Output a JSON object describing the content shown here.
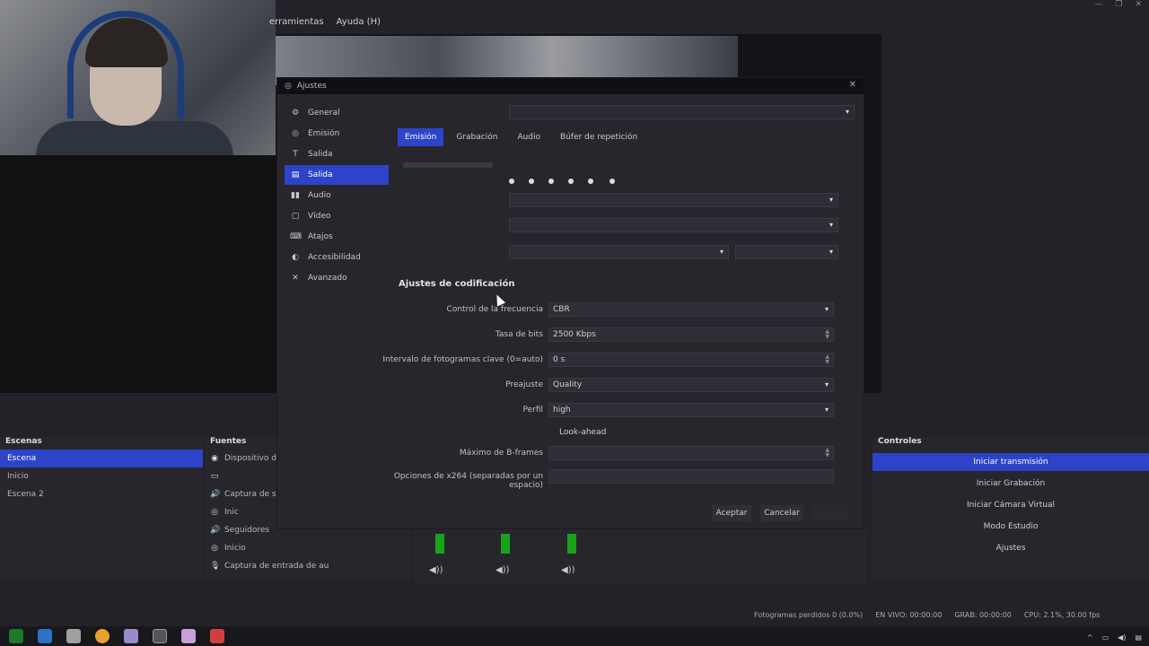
{
  "menubar": {
    "items": [
      "erramientas",
      "Ayuda (H)"
    ]
  },
  "window_controls": [
    "—",
    "❐",
    "✕"
  ],
  "scenes": {
    "title": "Escenas",
    "items": [
      {
        "label": "Escena",
        "selected": true
      },
      {
        "label": "Inicio",
        "selected": false
      },
      {
        "label": "Escena 2",
        "selected": false
      }
    ]
  },
  "sources": {
    "title": "Fuentes",
    "items": [
      {
        "icon": "camera-icon",
        "glyph": "◉",
        "label": "Dispositivo de c"
      },
      {
        "icon": "window-icon",
        "glyph": "▭",
        "label": ""
      },
      {
        "icon": "speaker-icon",
        "glyph": "🔊",
        "label": "Captura de s"
      },
      {
        "icon": "globe-icon",
        "glyph": "◎",
        "label": "Inic"
      },
      {
        "icon": "speaker-icon",
        "glyph": "🔊",
        "label": "Seguidores"
      },
      {
        "icon": "globe-icon",
        "glyph": "◎",
        "label": "Inicio"
      },
      {
        "icon": "mic-icon",
        "glyph": "🎙",
        "label": "Captura de entrada de au"
      }
    ]
  },
  "controls": {
    "title": "Controles",
    "buttons": [
      {
        "label": "Iniciar transmisión",
        "active": true
      },
      {
        "label": "Iniciar Grabación",
        "active": false
      },
      {
        "label": "Iniciar Cámara Virtual",
        "active": false
      },
      {
        "label": "Modo Estudio",
        "active": false
      },
      {
        "label": "Ajustes",
        "active": false
      }
    ]
  },
  "statusbar": {
    "items": [
      "Fotogramas perdidos 0 (0.0%)",
      "EN VIVO: 00:00:00",
      "GRAB: 00:00:00",
      "CPU: 2.1%, 30.00 fps"
    ]
  },
  "settings": {
    "title": "Ajustes",
    "nav": [
      {
        "icon": "gear-icon",
        "glyph": "⚙",
        "label": "General",
        "selected": false
      },
      {
        "icon": "stream-icon",
        "glyph": "◎",
        "label": "Emisión",
        "selected": false
      },
      {
        "icon": "output-icon",
        "glyph": "T",
        "label": "Salida",
        "selected": false
      },
      {
        "icon": "output-icon",
        "glyph": "▤",
        "label": "Salida",
        "selected": true
      },
      {
        "icon": "audio-icon",
        "glyph": "▮▮",
        "label": "Audio",
        "selected": false
      },
      {
        "icon": "video-icon",
        "glyph": "▢",
        "label": "Vídeo",
        "selected": false
      },
      {
        "icon": "hotkeys-icon",
        "glyph": "⌨",
        "label": "Atajos",
        "selected": false
      },
      {
        "icon": "accessibility-icon",
        "glyph": "◐",
        "label": "Accesibilidad",
        "selected": false
      },
      {
        "icon": "advanced-icon",
        "glyph": "✕",
        "label": "Avanzado",
        "selected": false
      }
    ],
    "tabs": [
      {
        "label": "Emisión",
        "selected": true
      },
      {
        "label": "Grabación",
        "selected": false
      },
      {
        "label": "Audio",
        "selected": false
      },
      {
        "label": "Búfer de repetición",
        "selected": false
      }
    ],
    "section_title": "Ajustes de codificación",
    "fields": [
      {
        "label": "Control de la frecuencia",
        "value": "CBR",
        "kind": "dropdown"
      },
      {
        "label": "Tasa de bits",
        "value": "2500 Kbps",
        "kind": "spin"
      },
      {
        "label": "Intervalo de fotogramas clave (0=auto)",
        "value": "0 s",
        "kind": "spin"
      },
      {
        "label": "Preajuste",
        "value": "Quality",
        "kind": "dropdown"
      },
      {
        "label": "Perfil",
        "value": "high",
        "kind": "dropdown"
      },
      {
        "label": "",
        "value": "Look-ahead",
        "kind": "checkbox"
      },
      {
        "label": "Máximo de B-frames",
        "value": "",
        "kind": "spin"
      },
      {
        "label": "Opciones de x264 (separadas por un espacio)",
        "value": "",
        "kind": "text"
      }
    ],
    "buttons": {
      "accept": "Aceptar",
      "cancel": "Cancelar"
    }
  },
  "colors": {
    "accent": "#2d44c9",
    "background": "#27262d",
    "meter": "#1aa31a"
  }
}
